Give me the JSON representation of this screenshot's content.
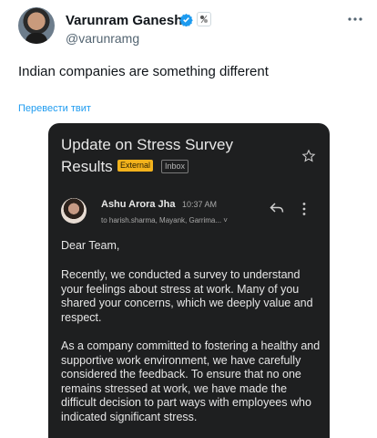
{
  "tweet": {
    "display_name": "Varunram Ganesh",
    "handle": "@varunramg",
    "text": "Indian companies are something different",
    "translate_label": "Перевести твит",
    "verified_icon": "verified-badge-icon",
    "more_icon": "more-horizontal-icon"
  },
  "email": {
    "subject_line1": "Update on Stress Survey",
    "subject_line2": "Results",
    "tag_external": "External",
    "tag_inbox": "Inbox",
    "sender_name": "Ashu Arora Jha",
    "time": "10:37 AM",
    "recipients": "to harish.sharma, Mayank, Garrima... ˅",
    "greeting": "Dear Team,",
    "paragraph1": "Recently, we conducted a survey to understand your feelings about stress at work. Many of you shared your concerns, which we deeply value and respect.",
    "paragraph2": "As a company committed to fostering a healthy and supportive work environment, we have carefully considered the feedback. To ensure that no one remains stressed at work, we have made the difficult decision to part ways with employees who indicated significant stress."
  },
  "colors": {
    "accent": "#1d9bf0",
    "email_bg": "#1e1f20",
    "external_tag": "#f2b21c"
  }
}
